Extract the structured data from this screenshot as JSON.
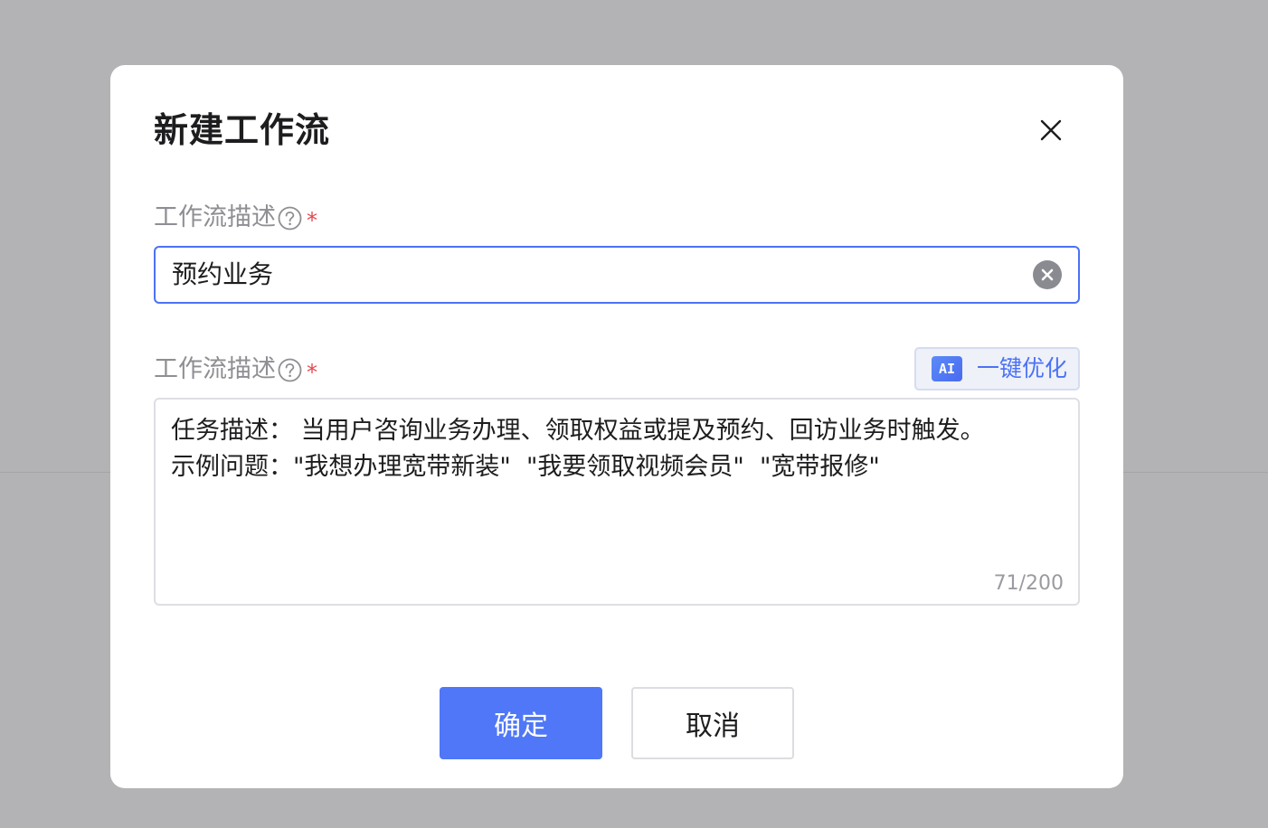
{
  "dialog": {
    "title": "新建工作流",
    "close_icon": "close-icon"
  },
  "field1": {
    "label": "工作流描述",
    "required_mark": "*",
    "help_icon": "question-circle-icon",
    "value": "预约业务",
    "clear_icon": "clear-circle-icon"
  },
  "field2": {
    "label": "工作流描述",
    "required_mark": "*",
    "help_icon": "question-circle-icon",
    "ai_badge": "AI",
    "ai_button_label": "一键优化",
    "lines": [
      "任务描述： 当用户咨询业务办理、领取权益或提及预约、回访业务时触发。",
      "示例问题：\"我想办理宽带新装\"  \"我要领取视频会员\"  \"宽带报修\""
    ],
    "counter": "71/200"
  },
  "footer": {
    "confirm_label": "确定",
    "cancel_label": "取消"
  },
  "colors": {
    "primary": "#4f77f7",
    "overlay": "#b3b3b6",
    "required": "#e5484d"
  }
}
